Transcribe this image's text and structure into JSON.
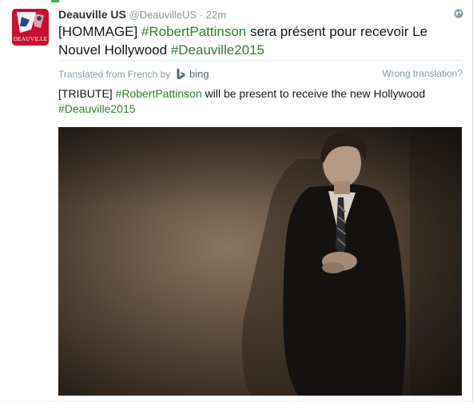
{
  "tweet": {
    "display_name": "Deauville US",
    "handle": "@DeauvilleUS",
    "separator": "·",
    "time": "22m",
    "avatar_text": "DEAUVILLE",
    "text_parts": {
      "p1": "[HOMMAGE] ",
      "hashtag1": "#RobertPattinson",
      "p2": " sera présent pour recevoir Le Nouvel Hollywood ",
      "hashtag2": "#Deauville2015"
    },
    "translation": {
      "label": "Translated from French by",
      "provider": "bing",
      "wrong_link": "Wrong translation?",
      "text_parts": {
        "p1": "[TRIBUTE] ",
        "hashtag1": "#RobertPattinson",
        "p2": " will be present to receive the new Hollywood ",
        "hashtag2": "#Deauville2015"
      }
    }
  },
  "icons": {
    "globe": "globe-icon",
    "bing": "bing-logo-icon"
  },
  "colors": {
    "hashtag": "#2e7d32",
    "meta": "#8899a6",
    "avatar_bg": "#c8102e"
  }
}
